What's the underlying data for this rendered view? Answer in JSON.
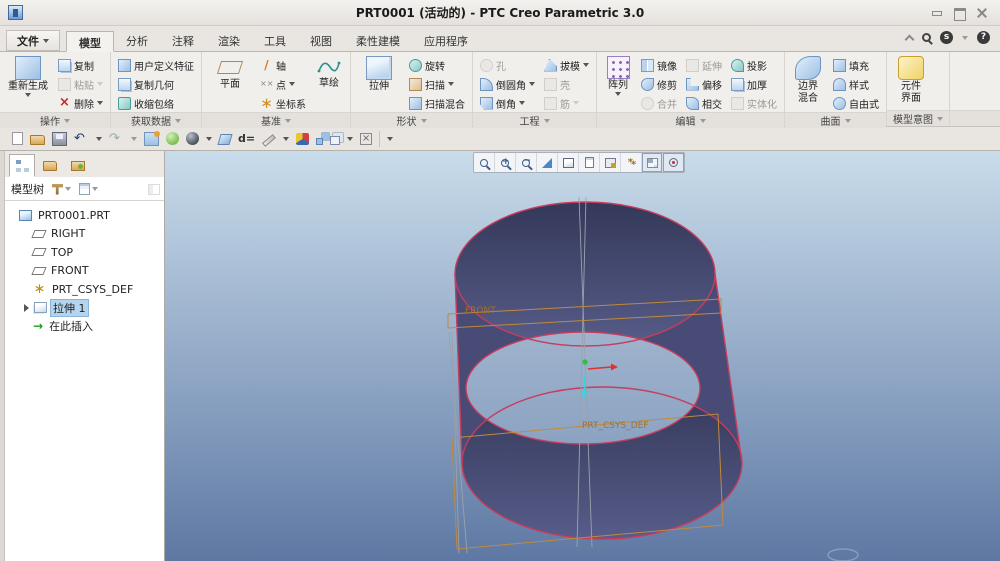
{
  "window": {
    "title": "PRT0001 (活动的) - PTC Creo Parametric 3.0"
  },
  "tabs": {
    "file": {
      "label": "文件"
    },
    "items": [
      {
        "label": "模型",
        "active": true
      },
      {
        "label": "分析",
        "active": false
      },
      {
        "label": "注释",
        "active": false
      },
      {
        "label": "渲染",
        "active": false
      },
      {
        "label": "工具",
        "active": false
      },
      {
        "label": "视图",
        "active": false
      },
      {
        "label": "柔性建模",
        "active": false
      },
      {
        "label": "应用程序",
        "active": false
      }
    ],
    "utility_icons": [
      "collapse-ribbon-icon",
      "command-search-icon",
      "community-icon",
      "help-icon"
    ]
  },
  "ribbon": {
    "groups": [
      {
        "label": "操作",
        "big": [
          {
            "label": "重新生成",
            "arrow": true
          }
        ],
        "cols": [
          [
            {
              "label": "复制"
            },
            {
              "label": "粘贴",
              "arrow": true,
              "disabled": true
            },
            {
              "label": "删除",
              "arrow": true
            }
          ]
        ]
      },
      {
        "label": "获取数据",
        "cols": [
          [
            {
              "label": "用户定义特征"
            },
            {
              "label": "复制几何"
            },
            {
              "label": "收缩包络"
            }
          ]
        ]
      },
      {
        "label": "基准",
        "big": [
          {
            "label": "平面"
          },
          {
            "label": "草绘"
          }
        ],
        "cols": [
          [
            {
              "label": "轴"
            },
            {
              "label": "点",
              "arrow": true
            },
            {
              "label": "坐标系"
            }
          ]
        ]
      },
      {
        "label": "形状",
        "big": [
          {
            "label": "拉伸"
          }
        ],
        "cols": [
          [
            {
              "label": "旋转"
            },
            {
              "label": "扫描",
              "arrow": true
            },
            {
              "label": "扫描混合"
            }
          ]
        ]
      },
      {
        "label": "工程",
        "cols": [
          [
            {
              "label": "孔",
              "disabled": true
            },
            {
              "label": "倒圆角",
              "arrow": true
            },
            {
              "label": "倒角",
              "arrow": true
            }
          ],
          [
            {
              "label": "拔模",
              "arrow": true
            },
            {
              "label": "壳",
              "disabled": true
            },
            {
              "label": "筋",
              "arrow": true,
              "disabled": true
            }
          ]
        ]
      },
      {
        "label": "编辑",
        "big": [
          {
            "label": "阵列",
            "arrow": true
          }
        ],
        "cols": [
          [
            {
              "label": "镜像"
            },
            {
              "label": "修剪"
            },
            {
              "label": "合并",
              "disabled": true
            }
          ],
          [
            {
              "label": "延伸",
              "disabled": true
            },
            {
              "label": "偏移"
            },
            {
              "label": "相交"
            }
          ],
          [
            {
              "label": "投影"
            },
            {
              "label": "加厚"
            },
            {
              "label": "实体化",
              "disabled": true
            }
          ]
        ]
      },
      {
        "label": "曲面",
        "big": [
          {
            "label": "边界混合"
          }
        ],
        "cols": [
          [
            {
              "label": "填充"
            },
            {
              "label": "样式"
            },
            {
              "label": "自由式"
            }
          ]
        ]
      },
      {
        "label": "模型意图",
        "big": [
          {
            "label": "元件界面"
          }
        ]
      }
    ]
  },
  "quickbar": {
    "icons": [
      "new-file-icon",
      "open-file-icon",
      "save-icon",
      "undo-icon",
      "redo-icon",
      "regenerate-icon",
      "render-sphere-icon",
      "shade-sphere-icon",
      "plane-display-icon",
      "dimension-icon",
      "measure-icon",
      "appearance-gallery-icon",
      "component-icon",
      "windows-icon",
      "close-window-icon",
      "more-commands-icon"
    ],
    "dim_label": "d="
  },
  "model_tree": {
    "title": "模型树",
    "tab_icons": [
      "model-tree-tab-icon",
      "folder-browser-tab-icon",
      "favorites-tab-icon"
    ],
    "items": [
      {
        "label": "PRT0001.PRT",
        "icon": "part",
        "selected": false
      },
      {
        "label": "RIGHT",
        "icon": "datum-plane",
        "selected": false
      },
      {
        "label": "TOP",
        "icon": "datum-plane",
        "selected": false
      },
      {
        "label": "FRONT",
        "icon": "datum-plane",
        "selected": false
      },
      {
        "label": "PRT_CSYS_DEF",
        "icon": "csys",
        "selected": false
      },
      {
        "label": "拉伸 1",
        "icon": "extrude-feature",
        "selected": true,
        "expandable": true
      },
      {
        "label": "在此插入",
        "icon": "insert-here",
        "selected": false
      }
    ]
  },
  "viewport": {
    "toolbar_icons": [
      "refit-icon",
      "zoom-in-icon",
      "zoom-out-icon",
      "repaint-icon",
      "display-style-icon",
      "saved-orientations-icon",
      "view-manager-icon",
      "datum-display-icon",
      "annotation-display-icon",
      "spin-center-icon"
    ],
    "toolbar_pressed": [
      "annotation-display-icon",
      "spin-center-icon"
    ],
    "labels": {
      "front_plane": "FRONT",
      "csys": "PRT_CSYS_DEF"
    },
    "colors": {
      "bg_top": "#c9dcea",
      "bg_mid": "#94abc8",
      "bg_bottom": "#5e78a3",
      "surface_dark": "#373b61",
      "surface_light": "#575c89",
      "edge": "#c83c5c",
      "datum_line": "#c08a3e",
      "datum_text": "#a8701e",
      "csys_x_axis": "#e03030",
      "csys_y_axis": "#40d0e0",
      "csys_origin": "#30c040"
    }
  }
}
